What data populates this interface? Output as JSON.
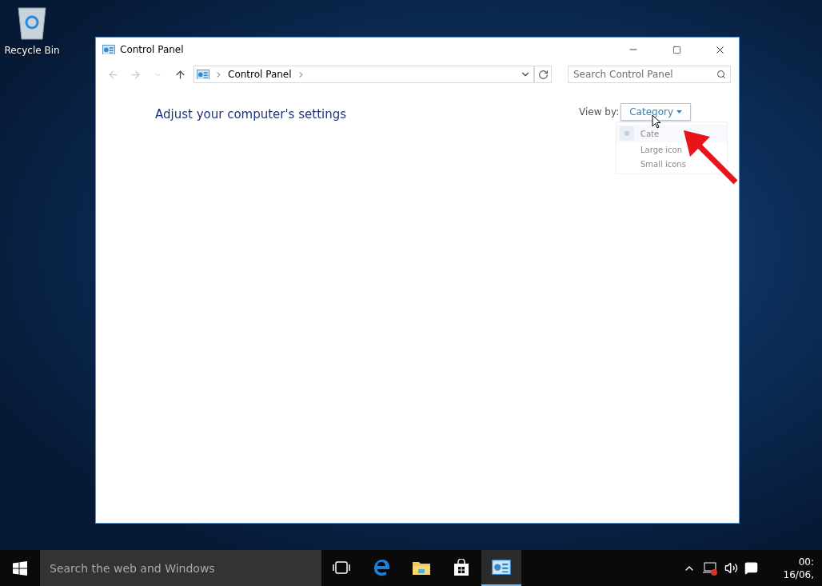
{
  "desktop": {
    "icons": [
      {
        "label": "Recycle Bin"
      }
    ]
  },
  "window": {
    "title": "Control Panel",
    "address": {
      "path": [
        "Control Panel"
      ]
    },
    "search": {
      "placeholder": "Search Control Panel"
    },
    "heading": "Adjust your computer's settings",
    "view_by": {
      "label": "View by:",
      "value": "Category",
      "menu": [
        {
          "label": "Cate",
          "selected": true
        },
        {
          "label": "Large icon",
          "selected": false
        },
        {
          "label": "Small icons",
          "selected": false
        }
      ]
    }
  },
  "taskbar": {
    "search": {
      "placeholder": "Search the web and Windows"
    },
    "apps": [
      {
        "kind": "task-view",
        "active": false
      },
      {
        "kind": "browser",
        "active": false
      },
      {
        "kind": "folder",
        "active": false
      },
      {
        "kind": "store",
        "active": false
      },
      {
        "kind": "control-panel",
        "active": true
      }
    ],
    "clock": {
      "time": "00:",
      "date": "16/06,"
    }
  }
}
